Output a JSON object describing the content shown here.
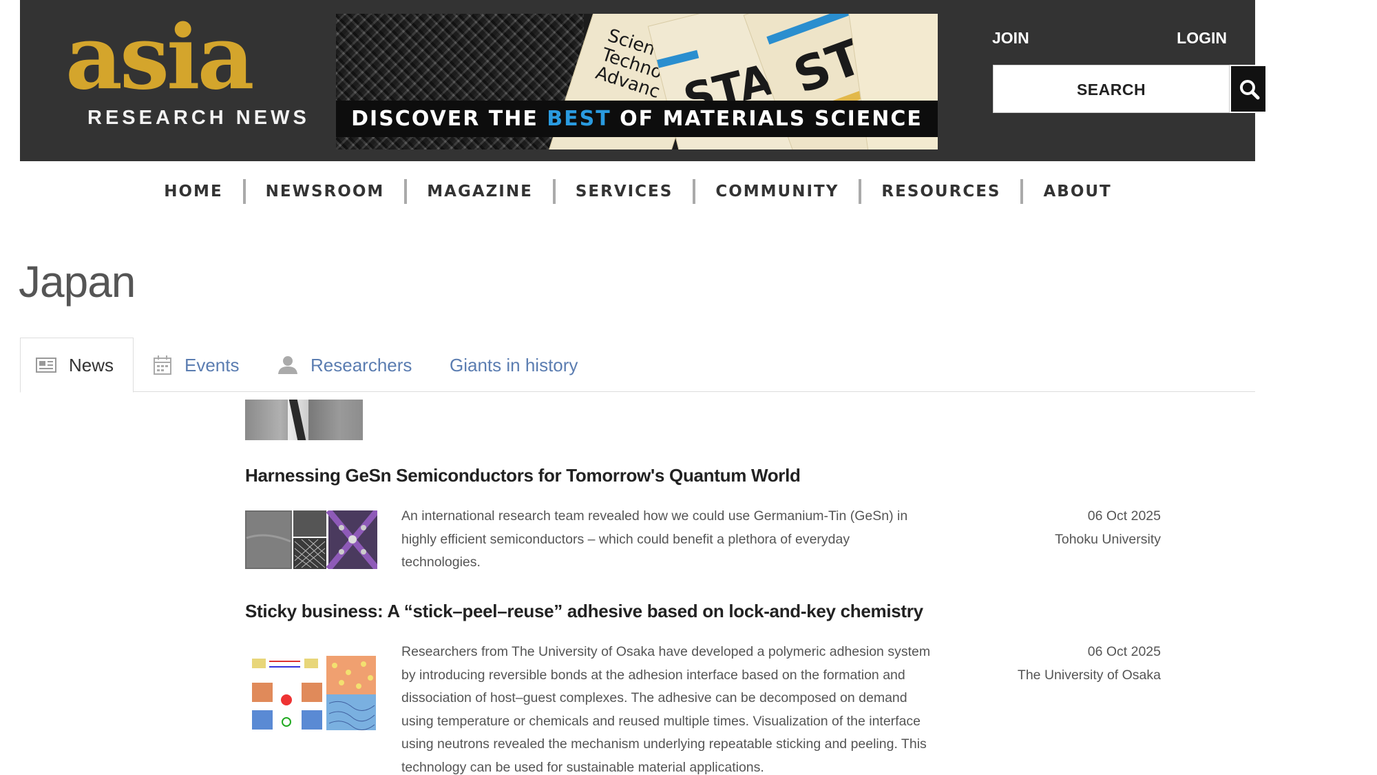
{
  "header": {
    "logo_main": "asia",
    "logo_sub": "RESEARCH NEWS",
    "join_label": "JOIN",
    "login_label": "LOGIN",
    "search_label": "SEARCH",
    "banner": {
      "text_before": "DISCOVER THE ",
      "text_highlight": "BEST",
      "text_after": " OF MATERIALS SCIENCE",
      "highlight_color": "#2a9be0",
      "journal_word": "STAM",
      "journal_fragment": "Science a Technology Advanc"
    }
  },
  "nav": {
    "items": [
      "HOME",
      "NEWSROOM",
      "MAGAZINE",
      "SERVICES",
      "COMMUNITY",
      "RESOURCES",
      "ABOUT"
    ]
  },
  "page": {
    "title": "Japan"
  },
  "tabs": [
    {
      "label": "News",
      "icon": "newspaper-icon",
      "active": true
    },
    {
      "label": "Events",
      "icon": "calendar-icon",
      "active": false
    },
    {
      "label": "Researchers",
      "icon": "person-icon",
      "active": false
    },
    {
      "label": "Giants in history",
      "icon": "",
      "active": false
    }
  ],
  "articles": [
    {
      "title": "Harnessing GeSn Semiconductors for Tomorrow's Quantum World",
      "description": "An international research team revealed how we could use Germanium-Tin (GeSn) in highly efficient semiconductors – which could benefit a plethora of everyday technologies.",
      "date": "06 Oct 2025",
      "institution": "Tohoku University"
    },
    {
      "title": "Sticky business: A “stick–peel–reuse” adhesive based on lock-and-key chemistry",
      "description": "Researchers from The University of Osaka have developed a polymeric adhesion system by introducing reversible bonds at the adhesion interface based on the formation and dissociation of host–guest complexes. The adhesive can be decomposed on demand using temperature or chemicals and reused multiple times. Visualization of the interface using neutrons revealed the mechanism underlying repeatable sticking and peeling. This technology can be used for sustainable material applications.",
      "date": "06 Oct 2025",
      "institution": "The University of Osaka"
    }
  ],
  "colors": {
    "header_bg": "#333333",
    "logo_gold": "#d4a52c",
    "link_blue": "#5b7db1"
  }
}
